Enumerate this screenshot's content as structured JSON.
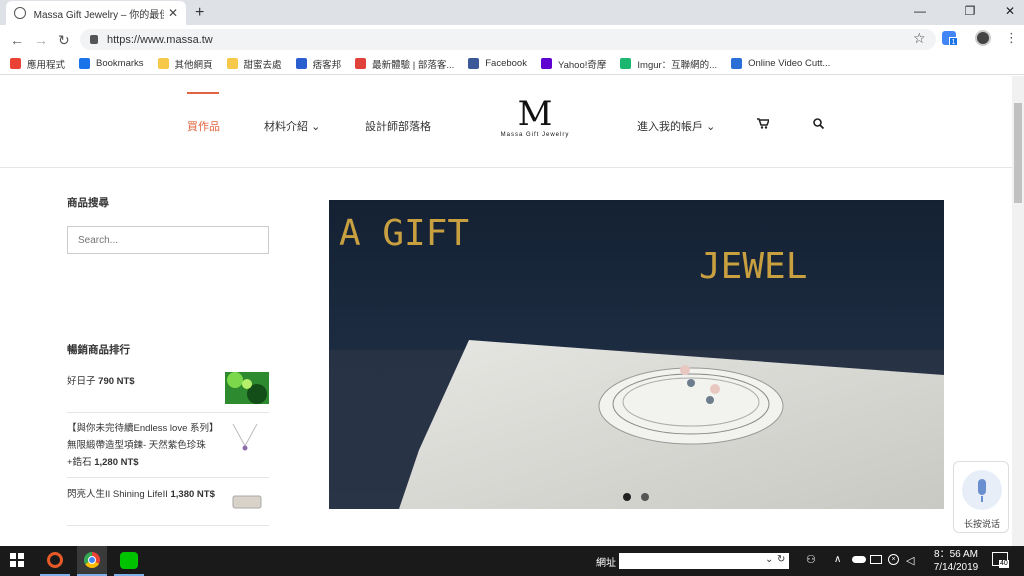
{
  "browser": {
    "tab_title": "Massa Gift Jewelry – 你的最佳女",
    "url": "https://www.massa.tw",
    "ext_badge": "1",
    "bookmarks": [
      {
        "label": "應用程式",
        "icon": "apps-grid-icon",
        "color": "#ea4335"
      },
      {
        "label": "Bookmarks",
        "icon": "star-icon",
        "color": "#1a73e8"
      },
      {
        "label": "其他網頁",
        "icon": "folder-icon",
        "color": "#f6c94a"
      },
      {
        "label": "甜蜜去處",
        "icon": "folder-icon",
        "color": "#f6c94a"
      },
      {
        "label": "痞客邦",
        "icon": "pixnet-icon",
        "color": "#2b5fcf"
      },
      {
        "label": "最新體驗 | 部落客...",
        "icon": "heart-icon",
        "color": "#e0413b"
      },
      {
        "label": "Facebook",
        "icon": "facebook-icon",
        "color": "#3b5998"
      },
      {
        "label": "Yahoo!奇摩",
        "icon": "yahoo-icon",
        "color": "#5f01d1"
      },
      {
        "label": "Imgur：互聯網的...",
        "icon": "imgur-icon",
        "color": "#1bb76e"
      },
      {
        "label": "Online Video Cutt...",
        "icon": "video-cutter-icon",
        "color": "#2a6fd6"
      }
    ]
  },
  "site": {
    "nav": {
      "products": "買作品",
      "materials": "材料介紹",
      "blog": "設計師部落格",
      "account": "進入我的帳戶"
    },
    "logo": {
      "mark": "M",
      "text": "Massa Gift Jewelry"
    },
    "sidebar": {
      "search_heading": "商品搜尋",
      "search_placeholder": "Search...",
      "bestsellers_heading": "暢銷商品排行",
      "products": [
        {
          "name": "好日子",
          "price": "790 NT$"
        },
        {
          "name": "【與你未完待續Endless love 系列】無限緞帶造型項鍊- 天然紫色珍珠+鋯",
          "name_tail": "石",
          "price": "1,280 NT$"
        },
        {
          "name": "閃亮人生II Shining LifeII",
          "price": "1,380 NT$"
        }
      ]
    },
    "slider": {
      "banner_text_1": "A  GIFT",
      "banner_text_2": "JEWEL",
      "active_slide": 1,
      "total_slides": 2
    },
    "voice_widget": "长按说话"
  },
  "taskbar": {
    "address_label": "網址",
    "time": "8：56 AM",
    "date": "7/14/2019",
    "notif_count": "40"
  }
}
